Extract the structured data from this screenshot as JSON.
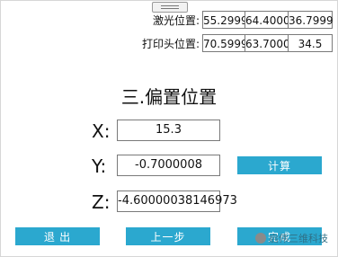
{
  "laser_position": {
    "label": "激光位置:",
    "values": [
      "55.2999",
      "64.4000",
      "36.7999"
    ]
  },
  "print_head_position": {
    "label": "打印头位置:",
    "values": [
      "70.5999",
      "63.7000",
      "34.5"
    ]
  },
  "section_title": "三.偏置位置",
  "offset": {
    "x_label": "X:",
    "x_value": "15.3",
    "y_label": "Y:",
    "y_value": "-0.7000008",
    "z_label": "Z:",
    "z_value": "-4.60000038146973"
  },
  "buttons": {
    "calculate": "计算",
    "exit": "退 出",
    "previous": "上一步",
    "finish": "完成"
  },
  "watermark": "启伟三维科技",
  "colors": {
    "button": "#2ba8cf"
  }
}
